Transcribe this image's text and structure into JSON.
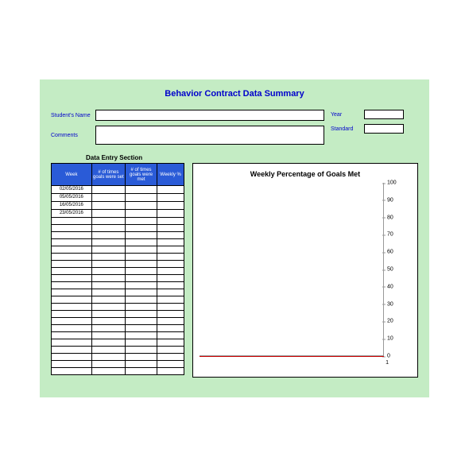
{
  "title": "Behavior Contract Data Summary",
  "form": {
    "student_label": "Student's Name",
    "comments_label": "Comments",
    "year_label": "Year",
    "standard_label": "Standard",
    "student_value": "",
    "comments_value": "",
    "year_value": "",
    "standard_value": ""
  },
  "section_label": "Data Entry Section",
  "table": {
    "headers": {
      "week": "Week",
      "goals_set": "# of times goals were set",
      "goals_met": "# of times goals were met",
      "weekly_pct": "Weekly %"
    },
    "rows": [
      {
        "week": "02/05/2016",
        "set": "",
        "met": "",
        "pct": ""
      },
      {
        "week": "05/05/2016",
        "set": "",
        "met": "",
        "pct": ""
      },
      {
        "week": "16/05/2016",
        "set": "",
        "met": "",
        "pct": ""
      },
      {
        "week": "23/05/2016",
        "set": "",
        "met": "",
        "pct": ""
      },
      {
        "week": "",
        "set": "",
        "met": "",
        "pct": ""
      },
      {
        "week": "",
        "set": "",
        "met": "",
        "pct": ""
      },
      {
        "week": "",
        "set": "",
        "met": "",
        "pct": ""
      },
      {
        "week": "",
        "set": "",
        "met": "",
        "pct": ""
      },
      {
        "week": "",
        "set": "",
        "met": "",
        "pct": ""
      },
      {
        "week": "",
        "set": "",
        "met": "",
        "pct": ""
      },
      {
        "week": "",
        "set": "",
        "met": "",
        "pct": ""
      },
      {
        "week": "",
        "set": "",
        "met": "",
        "pct": ""
      },
      {
        "week": "",
        "set": "",
        "met": "",
        "pct": ""
      },
      {
        "week": "",
        "set": "",
        "met": "",
        "pct": ""
      },
      {
        "week": "",
        "set": "",
        "met": "",
        "pct": ""
      },
      {
        "week": "",
        "set": "",
        "met": "",
        "pct": ""
      },
      {
        "week": "",
        "set": "",
        "met": "",
        "pct": ""
      },
      {
        "week": "",
        "set": "",
        "met": "",
        "pct": ""
      },
      {
        "week": "",
        "set": "",
        "met": "",
        "pct": ""
      },
      {
        "week": "",
        "set": "",
        "met": "",
        "pct": ""
      },
      {
        "week": "",
        "set": "",
        "met": "",
        "pct": ""
      },
      {
        "week": "",
        "set": "",
        "met": "",
        "pct": ""
      },
      {
        "week": "",
        "set": "",
        "met": "",
        "pct": ""
      },
      {
        "week": "",
        "set": "",
        "met": "",
        "pct": ""
      },
      {
        "week": "",
        "set": "",
        "met": "",
        "pct": ""
      },
      {
        "week": "",
        "set": "",
        "met": "",
        "pct": ""
      }
    ]
  },
  "chart_data": {
    "type": "line",
    "title": "Weekly Percentage of Goals Met",
    "xlabel": "",
    "ylabel": "",
    "ylim": [
      0,
      100
    ],
    "yticks": [
      0,
      10,
      20,
      30,
      40,
      50,
      60,
      70,
      80,
      90,
      100
    ],
    "x": [
      1
    ],
    "series": [
      {
        "name": "Weekly %",
        "values": [
          0
        ]
      }
    ],
    "xtick_label": "1"
  }
}
